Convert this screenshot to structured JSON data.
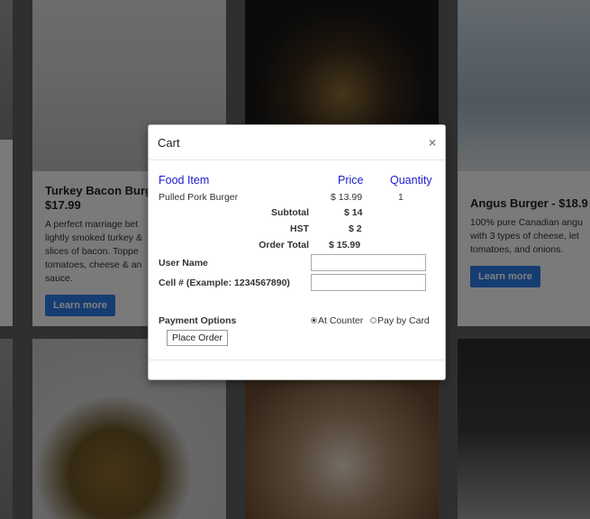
{
  "cards": [
    {
      "title": "Turkey Bacon Burg",
      "price": "$17.99",
      "desc": "A perfect marriage bet lightly smoked turkey & slices of bacon. Toppe tomatoes, cheese & an sauce.",
      "button": "Learn more"
    },
    {
      "title": "Angus Burger - $18.9",
      "desc": "100% pure Canadian angu with 3 types of cheese, let tomatoes, and onions.",
      "button": "Learn more"
    }
  ],
  "modal": {
    "title": "Cart",
    "close": "×",
    "columns": {
      "item": "Food Item",
      "price": "Price",
      "qty": "Quantity"
    },
    "rows": [
      {
        "item": "Pulled Pork Burger",
        "price": "$ 13.99",
        "qty": "1"
      }
    ],
    "totals": {
      "subtotal_label": "Subtotal",
      "subtotal": "$ 14",
      "hst_label": "HST",
      "hst": "$ 2",
      "total_label": "Order Total",
      "total": "$ 15.99"
    },
    "form": {
      "username_label": "User Name",
      "username_value": "",
      "cell_label": "Cell # (Example: 1234567890)",
      "cell_value": ""
    },
    "payment": {
      "label": "Payment Options",
      "options": [
        "At Counter",
        "Pay by Card"
      ],
      "selected": "At Counter"
    },
    "place_order": "Place Order"
  }
}
